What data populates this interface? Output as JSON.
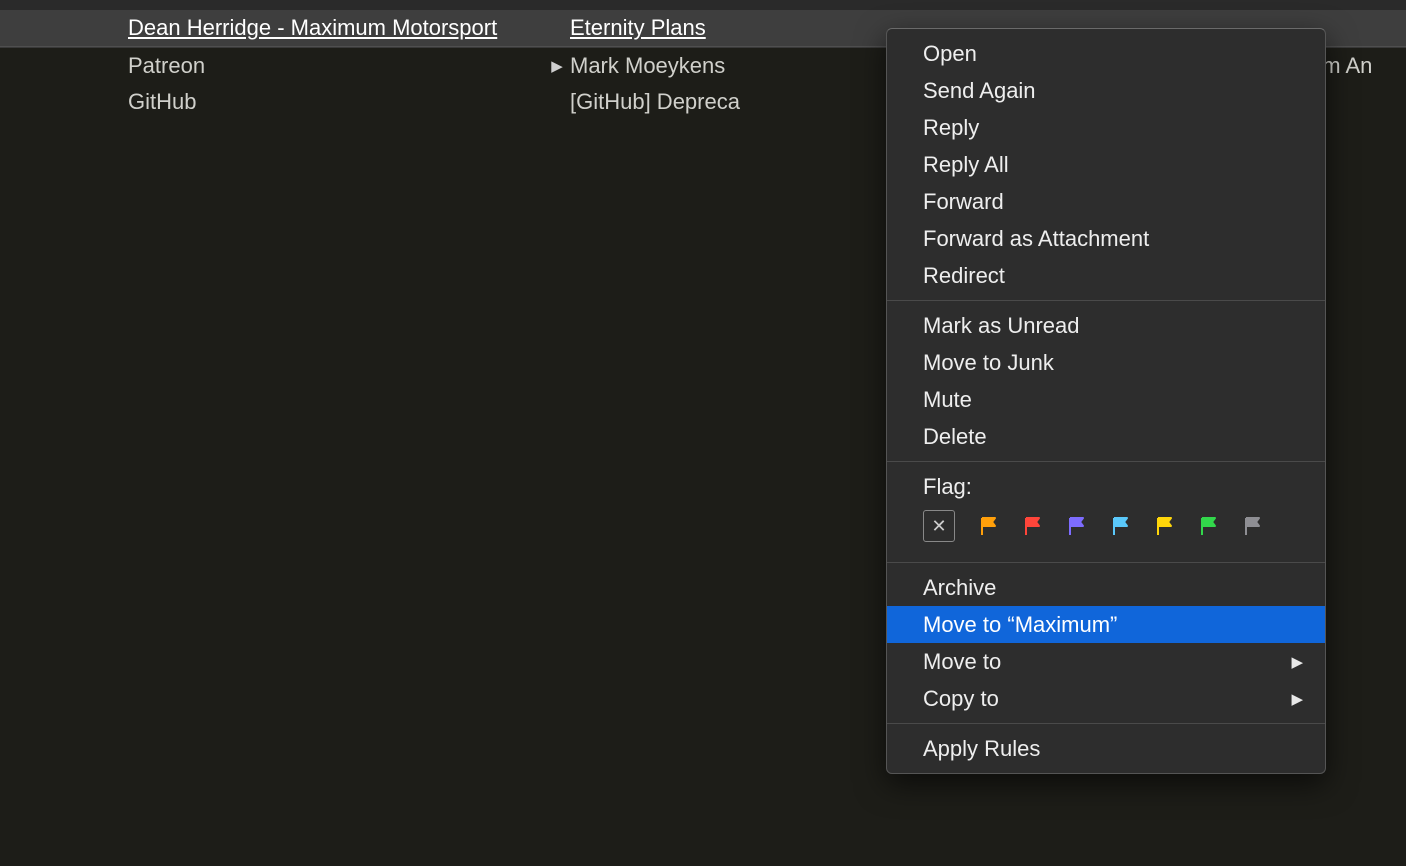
{
  "rows": [
    {
      "sender": "Dean Herridge - Maximum Motorsport",
      "subject": "Eternity Plans",
      "selected": true,
      "hasThread": false,
      "rightFrom": ""
    },
    {
      "sender": "Patreon",
      "subject": "Mark Moeykens",
      "selected": false,
      "hasThread": true,
      "rightFrom": "om An"
    },
    {
      "sender": "GitHub",
      "subject": "[GitHub] Depreca",
      "selected": false,
      "hasThread": false,
      "rightFrom": ""
    }
  ],
  "contextMenu": {
    "group1": [
      "Open",
      "Send Again",
      "Reply",
      "Reply All",
      "Forward",
      "Forward as Attachment",
      "Redirect"
    ],
    "group2": [
      "Mark as Unread",
      "Move to Junk",
      "Mute",
      "Delete"
    ],
    "flagLabel": "Flag:",
    "flags": [
      {
        "name": "clear",
        "color": ""
      },
      {
        "name": "orange",
        "color": "#ff9f0a"
      },
      {
        "name": "red",
        "color": "#ff453a"
      },
      {
        "name": "purple",
        "color": "#7d6cff"
      },
      {
        "name": "blue",
        "color": "#5ac8fa"
      },
      {
        "name": "yellow",
        "color": "#ffd60a"
      },
      {
        "name": "green",
        "color": "#32d74b"
      },
      {
        "name": "gray",
        "color": "#8e8e93"
      }
    ],
    "group3": [
      {
        "label": "Archive",
        "submenu": false,
        "highlight": false
      },
      {
        "label": "Move to “Maximum”",
        "submenu": false,
        "highlight": true
      },
      {
        "label": "Move to",
        "submenu": true,
        "highlight": false
      },
      {
        "label": "Copy to",
        "submenu": true,
        "highlight": false
      }
    ],
    "group4": [
      "Apply Rules"
    ]
  }
}
